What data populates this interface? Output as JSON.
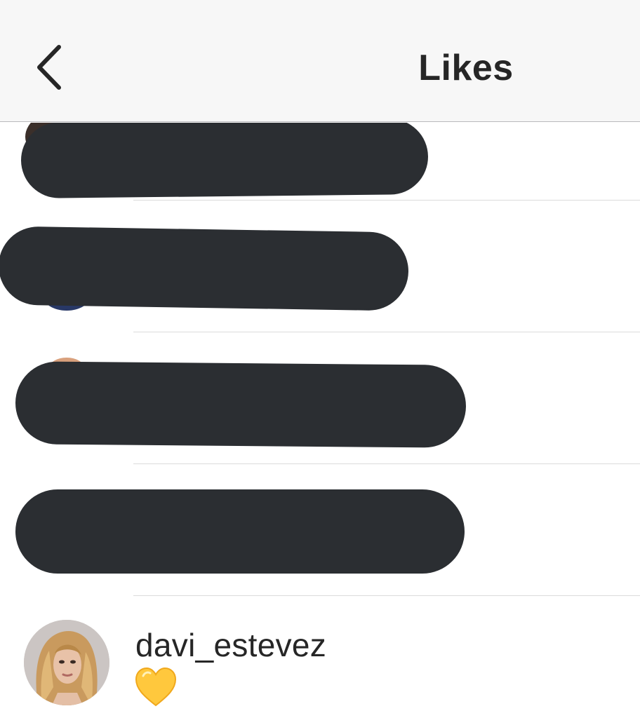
{
  "header": {
    "title": "Likes",
    "back_icon": "chevron-left-icon"
  },
  "likes": [
    {
      "redacted": true
    },
    {
      "redacted": true
    },
    {
      "redacted": true
    },
    {
      "redacted": true
    },
    {
      "redacted": false,
      "username": "davi_estevez",
      "caption_emoji": "💛",
      "caption_icon": "yellow-heart-icon"
    }
  ],
  "colors": {
    "redaction": "#2b2e32",
    "nav_background": "#f7f7f7",
    "text": "#262626",
    "divider": "#dbdbdb",
    "heart": "#ffcc33"
  }
}
